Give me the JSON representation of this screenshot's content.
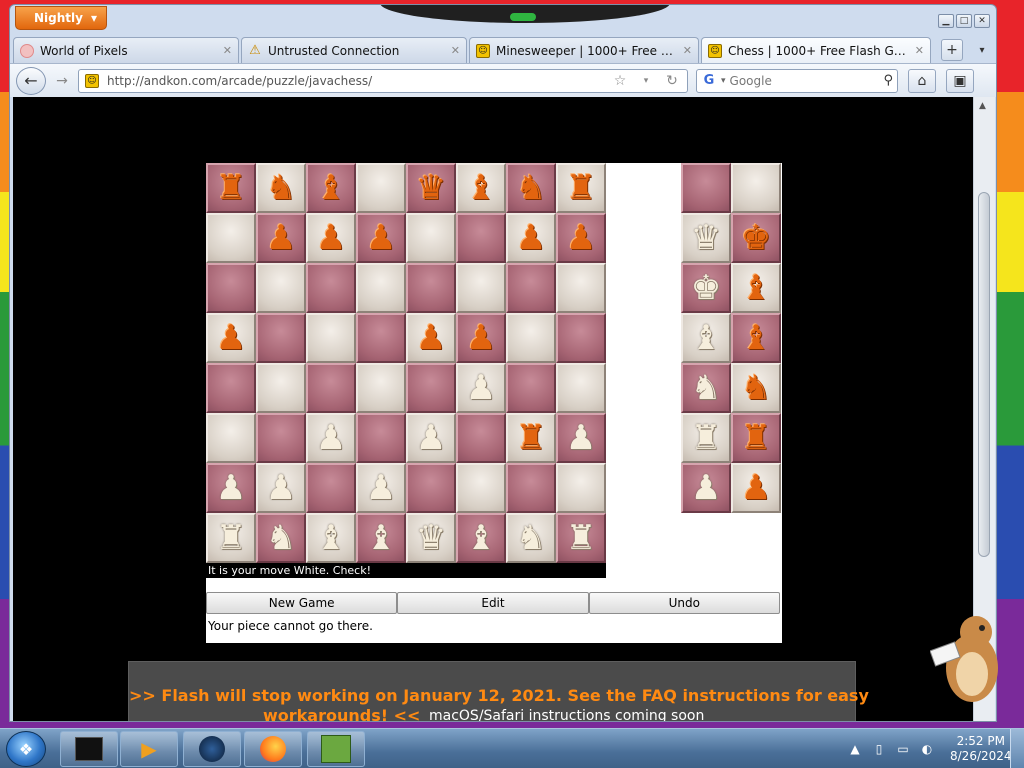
{
  "browser": {
    "app_button": "Nightly",
    "tabs": [
      {
        "label": "World of Pixels",
        "icon": "pixels-icon",
        "active": false
      },
      {
        "label": "Untrusted Connection",
        "icon": "warning-icon",
        "active": false
      },
      {
        "label": "Minesweeper | 1000+ Free Flash G...",
        "icon": "andkon-icon",
        "active": false
      },
      {
        "label": "Chess | 1000+ Free Flash Games | ...",
        "icon": "andkon-icon",
        "active": true
      }
    ],
    "url": "http://andkon.com/arcade/puzzle/javachess/",
    "search_placeholder": "Google"
  },
  "chess": {
    "board": [
      [
        "r",
        "n",
        "b",
        "",
        "q",
        "b",
        "n",
        "r"
      ],
      [
        "",
        "p",
        "p",
        "p",
        "",
        "",
        "p",
        "p"
      ],
      [
        "",
        "",
        "",
        "",
        "",
        "",
        "",
        ""
      ],
      [
        "p",
        "",
        "",
        "",
        "p",
        "p",
        "",
        ""
      ],
      [
        "",
        "",
        "",
        "",
        "",
        "P",
        "",
        ""
      ],
      [
        "",
        "",
        "P",
        "",
        "P",
        "",
        "r",
        "P"
      ],
      [
        "P",
        "P",
        "",
        "P",
        "",
        "",
        "",
        ""
      ],
      [
        "R",
        "N",
        "B",
        "B",
        "Q",
        "B",
        "N",
        "R"
      ]
    ],
    "captured": [
      [
        "",
        ""
      ],
      [
        "Q",
        "k"
      ],
      [
        "K",
        "b"
      ],
      [
        "B",
        "b"
      ],
      [
        "N",
        "n"
      ],
      [
        "R",
        "r"
      ],
      [
        "P",
        "p"
      ]
    ],
    "status": "It is your move White. Check!",
    "buttons": {
      "new_game": "New Game",
      "edit": "Edit",
      "undo": "Undo"
    },
    "message": "Your piece cannot go there."
  },
  "banner": {
    "line1": ">> Flash will stop working on January 12, 2021. See the FAQ instructions for easy",
    "line2": "workarounds! <<",
    "line3": "macOS/Safari instructions coming soon"
  },
  "taskbar": {
    "items": [
      "terminal-icon",
      "media-player-icon",
      "globe-icon",
      "firefox-icon",
      "game-box-icon"
    ],
    "time": "2:52 PM",
    "date": "8/26/2024"
  }
}
